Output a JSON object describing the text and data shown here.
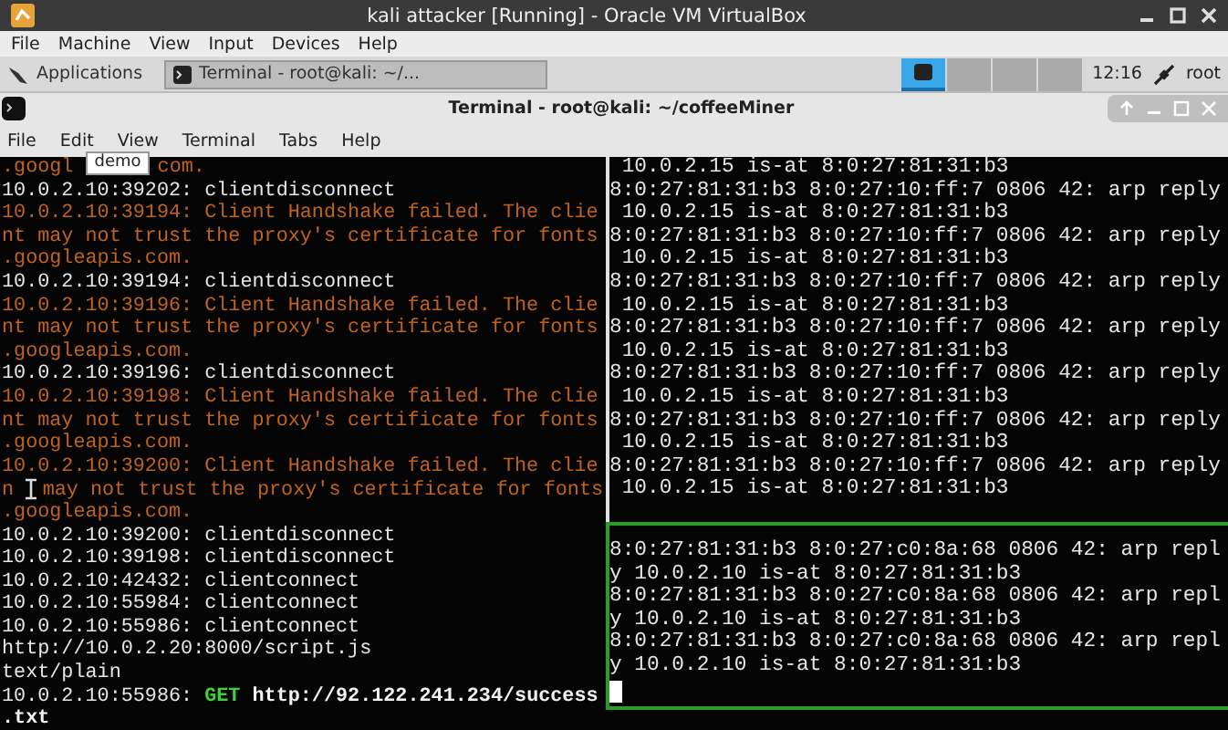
{
  "window": {
    "title": "kali attacker [Running] - Oracle VM VirtualBox"
  },
  "menu": [
    "File",
    "Machine",
    "View",
    "Input",
    "Devices",
    "Help"
  ],
  "panel": {
    "applications": "Applications",
    "tasks": [
      {
        "label": "Terminal - root@kali: ~/...",
        "selected": true
      }
    ],
    "workspaces": [
      {
        "selected": true
      },
      {
        "selected": false
      },
      {
        "selected": false
      },
      {
        "selected": false
      }
    ],
    "clock": "12:16",
    "user": "root"
  },
  "terminal": {
    "title": "Terminal - root@kali: ~/coffeeMiner",
    "menu": [
      "File",
      "Edit",
      "View",
      "Terminal",
      "Tabs",
      "Help"
    ],
    "left": [
      {
        "segments": [
          {
            "text": ".googl",
            "kind": "error"
          },
          {
            "text": "demo",
            "kind": "tooltip"
          },
          {
            "text": "com.",
            "kind": "error"
          }
        ]
      },
      {
        "segments": [
          {
            "text": "10.0.2.10:39202: clientdisconnect",
            "kind": "plain"
          }
        ]
      },
      {
        "segments": [
          {
            "text": "10.0.2.10:39194: Client Handshake failed. The clie",
            "kind": "error"
          }
        ]
      },
      {
        "segments": [
          {
            "text": "nt may not trust the proxy's certificate for fonts",
            "kind": "error"
          }
        ]
      },
      {
        "segments": [
          {
            "text": ".googleapis.com.",
            "kind": "error"
          }
        ]
      },
      {
        "segments": [
          {
            "text": "10.0.2.10:39194: clientdisconnect",
            "kind": "plain"
          }
        ]
      },
      {
        "segments": [
          {
            "text": "10.0.2.10:39196: Client Handshake failed. The clie",
            "kind": "error"
          }
        ]
      },
      {
        "segments": [
          {
            "text": "nt may not trust the proxy's certificate for fonts",
            "kind": "error"
          }
        ]
      },
      {
        "segments": [
          {
            "text": ".googleapis.com.",
            "kind": "error"
          }
        ]
      },
      {
        "segments": [
          {
            "text": "10.0.2.10:39196: clientdisconnect",
            "kind": "plain"
          }
        ]
      },
      {
        "segments": [
          {
            "text": "10.0.2.10:39198: Client Handshake failed. The clie",
            "kind": "error"
          }
        ]
      },
      {
        "segments": [
          {
            "text": "nt may not trust the proxy's certificate for fonts",
            "kind": "error"
          }
        ]
      },
      {
        "segments": [
          {
            "text": ".googleapis.com.",
            "kind": "error"
          }
        ]
      },
      {
        "segments": [
          {
            "text": "10.0.2.10:39200: Client Handshake failed. The clie",
            "kind": "error"
          }
        ]
      },
      {
        "segments": [
          {
            "text": "n",
            "kind": "error"
          },
          {
            "kind": "pointer"
          },
          {
            "text": "may not trust the proxy's certificate for fonts",
            "kind": "error"
          }
        ]
      },
      {
        "segments": [
          {
            "text": ".googleapis.com.",
            "kind": "error"
          }
        ]
      },
      {
        "segments": [
          {
            "text": "10.0.2.10:39200: clientdisconnect",
            "kind": "plain"
          }
        ]
      },
      {
        "segments": [
          {
            "text": "10.0.2.10:39198: clientdisconnect",
            "kind": "plain"
          }
        ]
      },
      {
        "segments": [
          {
            "text": "10.0.2.10:42432: clientconnect",
            "kind": "plain"
          }
        ]
      },
      {
        "segments": [
          {
            "text": "10.0.2.10:55984: clientconnect",
            "kind": "plain"
          }
        ]
      },
      {
        "segments": [
          {
            "text": "10.0.2.10:55986: clientconnect",
            "kind": "plain"
          }
        ]
      },
      {
        "segments": [
          {
            "text": "http://10.0.2.20:8000/script.js",
            "kind": "plain"
          }
        ]
      },
      {
        "segments": [
          {
            "text": "text/plain",
            "kind": "plain"
          }
        ]
      },
      {
        "segments": [
          {
            "text": "10.0.2.10:55986:",
            "kind": "plain"
          },
          {
            "text": "GET",
            "kind": "method"
          },
          {
            "text": "http://92.122.241.234/success",
            "kind": "url"
          }
        ]
      },
      {
        "segments": [
          {
            "text": ".txt",
            "kind": "url"
          }
        ]
      }
    ],
    "right_top": [
      " 10.0.2.15 is-at 8:0:27:81:31:b3",
      "8:0:27:81:31:b3 8:0:27:10:ff:7 0806 42: arp reply",
      " 10.0.2.15 is-at 8:0:27:81:31:b3",
      "8:0:27:81:31:b3 8:0:27:10:ff:7 0806 42: arp reply",
      " 10.0.2.15 is-at 8:0:27:81:31:b3",
      "8:0:27:81:31:b3 8:0:27:10:ff:7 0806 42: arp reply",
      " 10.0.2.15 is-at 8:0:27:81:31:b3",
      "8:0:27:81:31:b3 8:0:27:10:ff:7 0806 42: arp reply",
      " 10.0.2.15 is-at 8:0:27:81:31:b3",
      "8:0:27:81:31:b3 8:0:27:10:ff:7 0806 42: arp reply",
      " 10.0.2.15 is-at 8:0:27:81:31:b3",
      "8:0:27:81:31:b3 8:0:27:10:ff:7 0806 42: arp reply",
      " 10.0.2.15 is-at 8:0:27:81:31:b3",
      "8:0:27:81:31:b3 8:0:27:10:ff:7 0806 42: arp reply",
      " 10.0.2.15 is-at 8:0:27:81:31:b3"
    ],
    "right_bottom": [
      "8:0:27:81:31:b3 8:0:27:c0:8a:68 0806 42: arp repl",
      "y 10.0.2.10 is-at 8:0:27:81:31:b3",
      "8:0:27:81:31:b3 8:0:27:c0:8a:68 0806 42: arp repl",
      "y 10.0.2.10 is-at 8:0:27:81:31:b3",
      "8:0:27:81:31:b3 8:0:27:c0:8a:68 0806 42: arp repl",
      "y 10.0.2.10 is-at 8:0:27:81:31:b3"
    ]
  }
}
